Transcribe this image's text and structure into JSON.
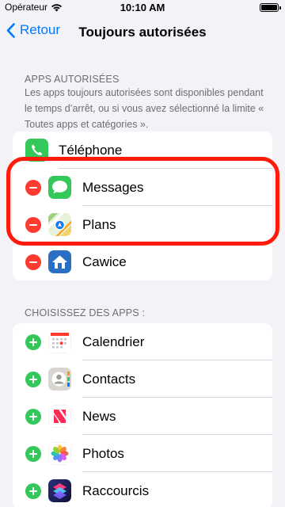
{
  "status_bar": {
    "carrier": "Opérateur",
    "time": "10:10 AM"
  },
  "nav": {
    "back_label": "Retour",
    "title": "Toujours autorisées"
  },
  "allowed_section": {
    "header": "APPS AUTORISÉES",
    "description": "Les apps toujours autorisées sont disponibles pendant le temps d’arrêt, ou si vous avez sélectionné la limite « Toutes apps et catégories ».",
    "items": [
      {
        "label": "Téléphone",
        "icon": "phone-icon",
        "removable": false
      },
      {
        "label": "Messages",
        "icon": "messages-icon",
        "removable": true
      },
      {
        "label": "Plans",
        "icon": "maps-icon",
        "removable": true
      },
      {
        "label": "Cawice",
        "icon": "home-app-icon",
        "removable": true
      }
    ]
  },
  "choose_section": {
    "header": "CHOISISSEZ DES APPS :",
    "items": [
      {
        "label": "Calendrier",
        "icon": "calendar-icon"
      },
      {
        "label": "Contacts",
        "icon": "contacts-icon"
      },
      {
        "label": "News",
        "icon": "news-icon"
      },
      {
        "label": "Photos",
        "icon": "photos-icon"
      },
      {
        "label": "Raccourcis",
        "icon": "shortcuts-icon"
      }
    ]
  },
  "colors": {
    "accent": "#007aff",
    "remove": "#ff3b30",
    "add": "#34c759",
    "highlight": "#ff1a0a"
  }
}
